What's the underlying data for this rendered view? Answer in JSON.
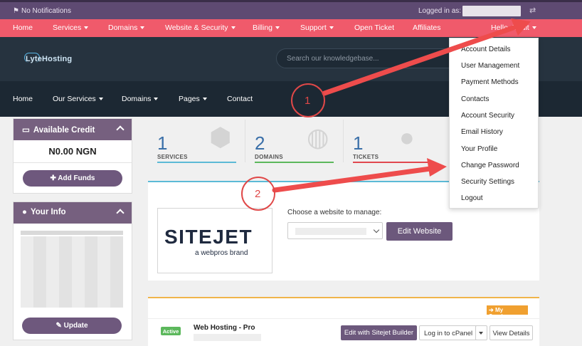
{
  "topbar": {
    "notifications": "No Notifications",
    "logged_in_as": "Logged in as:"
  },
  "rednav": {
    "items": [
      {
        "label": "Home",
        "caret": false
      },
      {
        "label": "Services",
        "caret": true
      },
      {
        "label": "Domains",
        "caret": true
      },
      {
        "label": "Website & Security",
        "caret": true
      },
      {
        "label": "Billing",
        "caret": true
      },
      {
        "label": "Support",
        "caret": true
      },
      {
        "label": "Open Ticket",
        "caret": false
      },
      {
        "label": "Affiliates",
        "caret": false
      },
      {
        "label": "Hello, Ebdit",
        "caret": true
      }
    ]
  },
  "header": {
    "logo_text": "LyteHosting",
    "search_placeholder": "Search our knowledgebase..."
  },
  "darknav": {
    "items": [
      {
        "label": "Home",
        "caret": false
      },
      {
        "label": "Our Services",
        "caret": true
      },
      {
        "label": "Domains",
        "caret": true
      },
      {
        "label": "Pages",
        "caret": true
      },
      {
        "label": "Contact",
        "caret": false
      }
    ]
  },
  "sidebar": {
    "credit": {
      "title": "Available Credit",
      "value": "N0.00 NGN",
      "add_funds": "Add Funds"
    },
    "info": {
      "title": "Your Info",
      "update": "Update"
    }
  },
  "stats": [
    {
      "value": "1",
      "label": "SERVICES",
      "color": "#5cbad6"
    },
    {
      "value": "2",
      "label": "DOMAINS",
      "color": "#5cb85c"
    },
    {
      "value": "1",
      "label": "TICKETS",
      "color": "#e0484f"
    }
  ],
  "sitejet_card": {
    "logo_main": "SITEJET",
    "logo_sub": "a webpros brand",
    "choose_label": "Choose a website to manage:",
    "edit_button": "Edit Website"
  },
  "services_card": {
    "my_services": "My Services",
    "status": "Active",
    "service_name": "Web Hosting - Pro",
    "edit_sitejet": "Edit with Sitejet Builder",
    "login_cpanel": "Log in to cPanel",
    "view_details": "View Details"
  },
  "dropdown": {
    "items": [
      "Account Details",
      "User Management",
      "Payment Methods",
      "Contacts",
      "Account Security",
      "Email History",
      "Your Profile",
      "Change Password",
      "Security Settings",
      "Logout"
    ]
  },
  "annotations": {
    "step1": "1",
    "step2": "2",
    "color": "#e84c4c"
  }
}
